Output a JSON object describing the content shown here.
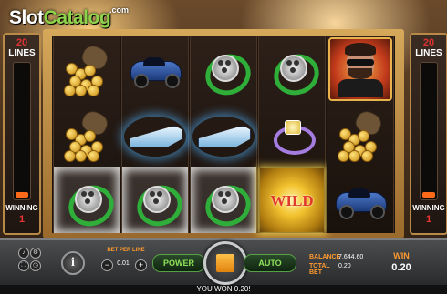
{
  "logo": {
    "part1": "Slot",
    "part2": "Catalog",
    "suffix": ".com"
  },
  "left_meter": {
    "lines_count": "20",
    "lines_label": "LINES",
    "winning_label": "WINNING",
    "winning_count": "1"
  },
  "right_meter": {
    "lines_count": "20",
    "lines_label": "LINES",
    "winning_label": "WINNING",
    "winning_count": "1"
  },
  "reels": [
    {
      "cells": [
        "money-bag",
        "money-bag",
        "watch"
      ],
      "win": [
        false,
        false,
        true
      ]
    },
    {
      "cells": [
        "sports-car",
        "speedboat",
        "watch"
      ],
      "win": [
        false,
        false,
        true
      ]
    },
    {
      "cells": [
        "watch",
        "speedboat",
        "watch"
      ],
      "win": [
        false,
        false,
        true
      ]
    },
    {
      "cells": [
        "watch",
        "diamond-ring",
        "wild"
      ],
      "win": [
        false,
        false,
        false
      ]
    },
    {
      "cells": [
        "bearded-man",
        "money-bag",
        "sports-car"
      ],
      "win": [
        false,
        false,
        false
      ]
    }
  ],
  "wild_text": "WILD",
  "controls": {
    "bet_per_line_label": "BET PER LINE",
    "bet_per_line_value": "0.01",
    "power_label": "POWER",
    "auto_label": "AUTO",
    "balance_label": "BALANCE",
    "balance_value": "7,644.60",
    "total_bet_label": "TOTAL BET",
    "total_bet_value": "0.20",
    "win_label": "WIN",
    "win_value": "0.20",
    "info_label": "i",
    "minus_label": "−",
    "plus_label": "+"
  },
  "message": "YOU WON 0.20!",
  "colors": {
    "accent_orange": "#ff9a2e",
    "accent_green": "#8fe35a",
    "lines_red": "#d33"
  }
}
